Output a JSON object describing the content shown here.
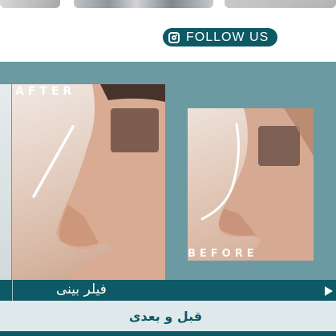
{
  "follow": {
    "label": "FOLLOW US",
    "icon": "instagram-icon"
  },
  "slider": {
    "after_label": "AFTER",
    "before_label": "BEFORE",
    "title": "فیلر بینی",
    "next_icon": "play-arrow-icon"
  },
  "caption": "قبل و بعدی",
  "colors": {
    "brand": "#0d5a66",
    "panel": "#6b9aa2",
    "caption_bg": "#dfe8ea"
  }
}
